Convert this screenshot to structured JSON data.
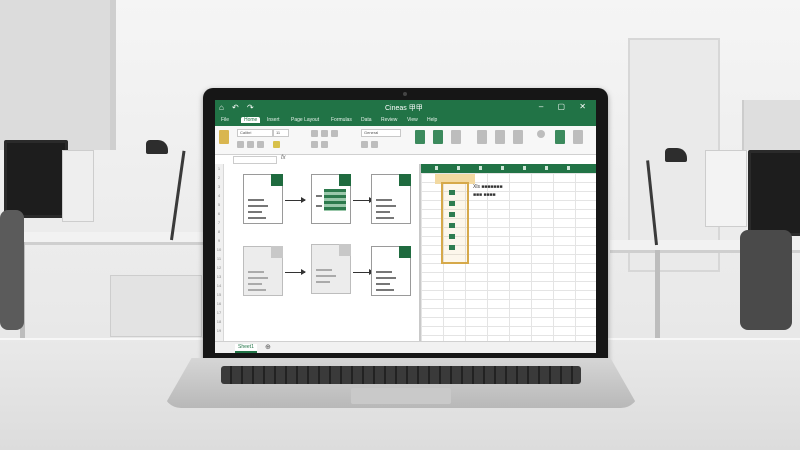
{
  "excel": {
    "quick_access": "⌂ ↶ ↷",
    "doc_title": "Cineas 甲甲",
    "window_controls": "– ▢ ✕",
    "tabs": [
      "File",
      "Home",
      "Insert",
      "Page Layout",
      "Formulas",
      "Data",
      "Review",
      "View",
      "Help"
    ],
    "ribbon": {
      "font_box": "Calibri",
      "font_size": "11",
      "number_format": "General"
    },
    "formula_bar": {
      "fx": "fx"
    },
    "column_headers": [
      "A",
      "B",
      "C",
      "D",
      "E",
      "F",
      "G"
    ],
    "row_numbers": [
      "1",
      "2",
      "3",
      "4",
      "5",
      "6",
      "7",
      "8",
      "9",
      "10",
      "11",
      "12",
      "13",
      "14",
      "15",
      "16",
      "17",
      "18",
      "19"
    ],
    "right_pane": {
      "cell_text_1": "Xls ■■■■■■■",
      "cell_text_2": "■■■ ■■■■"
    },
    "sheet_tab": "Sheet1",
    "add_sheet": "⊕"
  },
  "diagram": {
    "rows": [
      {
        "style": "green",
        "count": 3
      },
      {
        "style": "mixed",
        "count": 3
      }
    ]
  },
  "colors": {
    "excel_green": "#217346",
    "selection_gold": "#d6a94a"
  }
}
